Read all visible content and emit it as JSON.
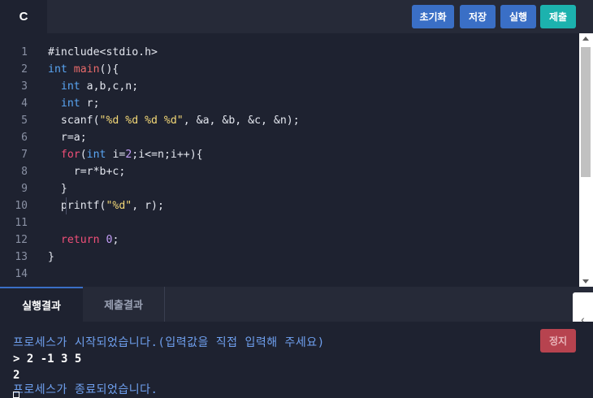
{
  "toolbar": {
    "language_tab": "C",
    "reset_label": "초기화",
    "save_label": "저장",
    "run_label": "실행",
    "submit_label": "제출",
    "colors": {
      "primary": "#3a6fc6",
      "submit": "#1cb2ae",
      "stop": "#b7434f"
    }
  },
  "editor": {
    "line_numbers": [
      "1",
      "2",
      "3",
      "4",
      "5",
      "6",
      "7",
      "8",
      "9",
      "10",
      "11",
      "12",
      "13",
      "14"
    ],
    "lines": [
      [
        {
          "t": "#include<stdio.h>",
          "c": ""
        }
      ],
      [
        {
          "t": "int",
          "c": "kw"
        },
        {
          "t": " ",
          "c": ""
        },
        {
          "t": "main",
          "c": "fn"
        },
        {
          "t": "(){",
          "c": ""
        }
      ],
      [
        {
          "t": "  ",
          "c": ""
        },
        {
          "t": "int",
          "c": "kw"
        },
        {
          "t": " a,b,c,n;",
          "c": ""
        }
      ],
      [
        {
          "t": "  ",
          "c": ""
        },
        {
          "t": "int",
          "c": "kw"
        },
        {
          "t": " r;",
          "c": ""
        }
      ],
      [
        {
          "t": "  scanf(",
          "c": ""
        },
        {
          "t": "\"%d %d %d %d\"",
          "c": "str"
        },
        {
          "t": ", &a, &b, &c, &n);",
          "c": ""
        }
      ],
      [
        {
          "t": "  r=a;",
          "c": ""
        }
      ],
      [
        {
          "t": "  ",
          "c": ""
        },
        {
          "t": "for",
          "c": "kw2"
        },
        {
          "t": "(",
          "c": ""
        },
        {
          "t": "int",
          "c": "kw"
        },
        {
          "t": " i=",
          "c": ""
        },
        {
          "t": "2",
          "c": "num"
        },
        {
          "t": ";i<=n;i++){",
          "c": ""
        }
      ],
      [
        {
          "t": "    r=r*b+c;",
          "c": ""
        }
      ],
      [
        {
          "t": "  }",
          "c": ""
        }
      ],
      [
        {
          "t": "  printf(",
          "c": ""
        },
        {
          "t": "\"%d\"",
          "c": "str"
        },
        {
          "t": ", r);",
          "c": ""
        }
      ],
      [
        {
          "t": "",
          "c": ""
        }
      ],
      [
        {
          "t": "  ",
          "c": ""
        },
        {
          "t": "return",
          "c": "kw2"
        },
        {
          "t": " ",
          "c": ""
        },
        {
          "t": "0",
          "c": "num"
        },
        {
          "t": ";",
          "c": ""
        }
      ],
      [
        {
          "t": "}",
          "c": ""
        }
      ],
      [
        {
          "t": "",
          "c": ""
        }
      ]
    ]
  },
  "result_panel": {
    "tab_result": "실행결과",
    "tab_submit_result": "제출결과",
    "stop_label": "정지",
    "collapse_icon": "chevron-left-icon",
    "output": {
      "line1": "프로세스가 시작되었습니다.(입력값을 직접 입력해 주세요)",
      "line2": "> 2 -1 3 5",
      "line3": "2",
      "line4": "프로세스가 종료되었습니다."
    }
  }
}
